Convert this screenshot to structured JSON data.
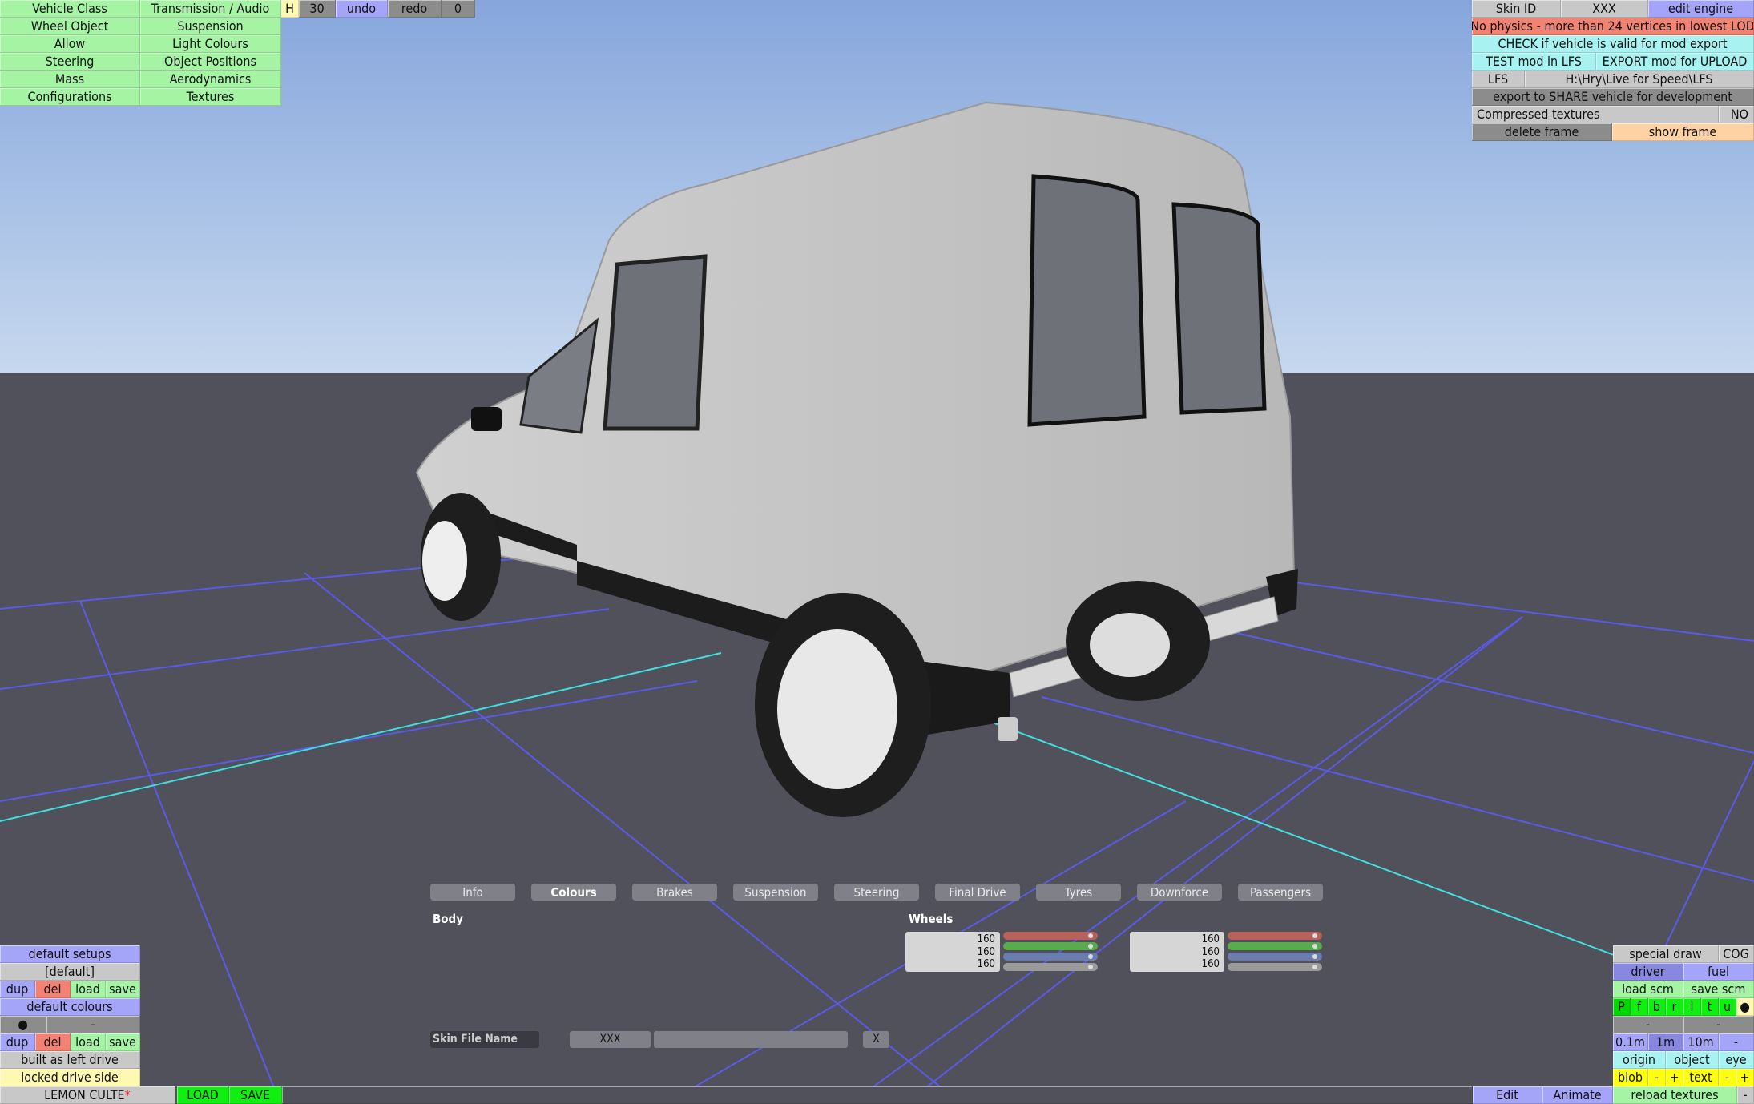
{
  "top_left_menu": {
    "col1": [
      "Vehicle Class",
      "Wheel Object",
      "Allow",
      "Steering",
      "Mass",
      "Configurations"
    ],
    "col2": [
      "Transmission / Audio",
      "Suspension",
      "Light Colours",
      "Object Positions",
      "Aerodynamics",
      "Textures"
    ]
  },
  "toolbar": {
    "h": "H",
    "value": "30",
    "undo": "undo",
    "redo": "redo",
    "count": "0"
  },
  "top_right": {
    "skin_id_label": "Skin ID",
    "skin_id": "XXX",
    "edit_engine": "edit engine",
    "warning": "No physics - more than 24 vertices in lowest LOD",
    "check": "CHECK if vehicle is valid for mod export",
    "test": "TEST mod in LFS",
    "export": "EXPORT mod for UPLOAD",
    "lfs_label": "LFS",
    "lfs_path": "H:\\Hry\\Live for Speed\\LFS",
    "share": "export to SHARE vehicle for development",
    "compressed_label": "Compressed textures",
    "compressed_value": "NO",
    "delete_frame": "delete frame",
    "show_frame": "show frame"
  },
  "bottom_left": {
    "default_setups": "default setups",
    "setup_value": "[default]",
    "dup": "dup",
    "del": "del",
    "load": "load",
    "save": "save",
    "default_colours": "default colours",
    "colour_dot": "●",
    "colour_value": "-",
    "built_as": "built as left drive",
    "locked": "locked drive side"
  },
  "bottom_right": {
    "special_draw": "special draw",
    "cog": "COG",
    "driver": "driver",
    "fuel": "fuel",
    "load_scm": "load scm",
    "save_scm": "save scm",
    "letters": [
      "P",
      "f",
      "b",
      "r",
      "l",
      "t",
      "u"
    ],
    "dot": "●",
    "dash1": "-",
    "dash2": "-",
    "grid": [
      "0.1m",
      "1m",
      "10m",
      "-"
    ],
    "origin": "origin",
    "object": "object",
    "eye": "eye",
    "blob": "blob",
    "blob_minus": "-",
    "blob_plus": "+",
    "text": "text",
    "text_minus": "-",
    "text_plus": "+"
  },
  "tabs": [
    "Info",
    "Colours",
    "Brakes",
    "Suspension",
    "Steering",
    "Final Drive",
    "Tyres",
    "Downforce",
    "Passengers"
  ],
  "active_tab": "Colours",
  "colours": {
    "body_label": "Body",
    "wheels_label": "Wheels",
    "wheels": [
      [
        "160",
        "160",
        "160"
      ],
      [
        "160",
        "160",
        "160"
      ]
    ]
  },
  "skin_file": {
    "label": "Skin File Name",
    "value": "XXX",
    "clear": "X"
  },
  "status": {
    "vehicle_name": "LEMON CULTE",
    "modified_marker": "*",
    "load": "LOAD",
    "save": "SAVE",
    "edit": "Edit",
    "animate": "Animate",
    "reload_textures": "reload textures",
    "minus": "-"
  },
  "colors": {
    "green": "#a4f4a4",
    "gray": "#c8c8c8",
    "dark_gray": "#8c8c8c",
    "blue": "#a4a4f8",
    "blue_dark": "#8888e0",
    "red": "#f28272",
    "cyan": "#a8f2f2",
    "orange": "#ffd2a4",
    "pale_yellow": "#fff8b0",
    "yellow": "#ffff10",
    "bright_green": "#10f010",
    "mid_green": "#00d800",
    "sky_top": "#86a6dc",
    "sky_horizon": "#c4d6ee",
    "ground": "#50515a",
    "grid": "#5a5ae8",
    "axis": "#40e0e0",
    "marker_red": "#ff2020"
  }
}
